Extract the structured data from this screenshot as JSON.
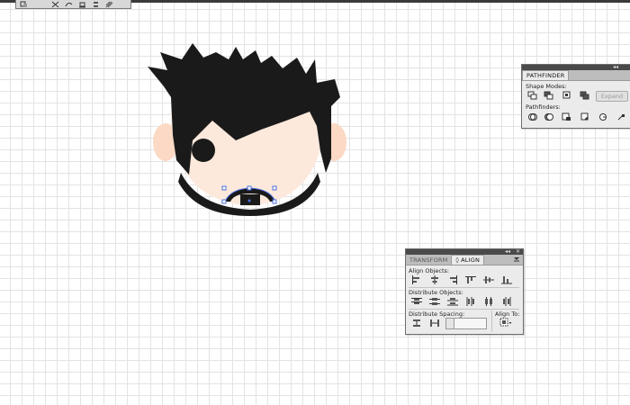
{
  "toolbar": {
    "icons": [
      "transform-icon",
      "scissors-icon",
      "path-icon",
      "align-icon",
      "distribute-icon",
      "hatch-icon"
    ]
  },
  "pathfinder": {
    "title": "PATHFINDER",
    "shape_modes_label": "Shape Modes:",
    "expand_label": "Expand",
    "pathfinders_label": "Pathfinders:"
  },
  "align": {
    "tabs": [
      "TRANSFORM",
      "◊ ALIGN"
    ],
    "align_objects_label": "Align Objects:",
    "distribute_objects_label": "Distribute Objects:",
    "distribute_spacing_label": "Distribute Spacing:",
    "align_to_label": "Align To:"
  },
  "colors": {
    "hair": "#1a1a1a",
    "skin": "#fde9dc",
    "ear": "#fbd9c4",
    "selection": "#4a6fe0"
  }
}
